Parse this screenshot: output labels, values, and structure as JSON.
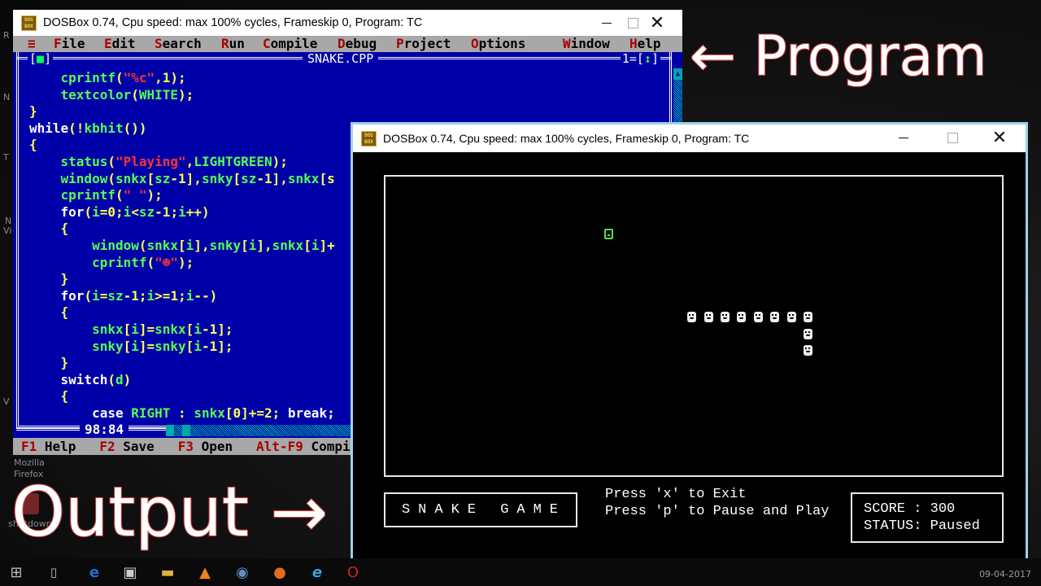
{
  "desktop": {
    "left_labels": [
      "R",
      "N",
      "T",
      "N",
      "Vi",
      "V"
    ],
    "icons": [
      {
        "label_line1": "Mozilla",
        "label_line2": "Firefox"
      },
      {
        "label_line1": "shutdown",
        "label_line2": ""
      }
    ]
  },
  "annotations": {
    "program": "← Program",
    "output": "Output →"
  },
  "ide_window": {
    "icon": "dosbox-icon",
    "icon_text": "DOS BOX",
    "title": "DOSBox 0.74, Cpu speed: max 100% cycles, Frameskip  0, Program:     TC",
    "controls": {
      "minimize": "—",
      "maximize": "☐",
      "close": "✕"
    },
    "menu": [
      {
        "hot": "≡",
        "rest": ""
      },
      {
        "hot": "F",
        "rest": "ile"
      },
      {
        "hot": "E",
        "rest": "dit"
      },
      {
        "hot": "S",
        "rest": "earch"
      },
      {
        "hot": "R",
        "rest": "un"
      },
      {
        "hot": "C",
        "rest": "ompile"
      },
      {
        "hot": "D",
        "rest": "ebug"
      },
      {
        "hot": "P",
        "rest": "roject"
      },
      {
        "hot": "O",
        "rest": "ptions"
      },
      {
        "hot": "W",
        "rest": "indow"
      },
      {
        "hot": "H",
        "rest": "elp"
      }
    ],
    "editor": {
      "close_box": "[",
      "close_box_mark": "■",
      "close_box_end": "]",
      "filename": "SNAKE.CPP",
      "window_number": "1=[",
      "zoom_mark": "↕",
      "window_number_end": "]",
      "cursor_position": "98:84",
      "code_lines": [
        [
          {
            "t": "    ",
            "c": "kw"
          },
          {
            "t": "cprintf",
            "c": "id"
          },
          {
            "t": "(",
            "c": "pn"
          },
          {
            "t": "\"%c\"",
            "c": "st"
          },
          {
            "t": ",1);",
            "c": "pn"
          }
        ],
        [
          {
            "t": "    ",
            "c": "kw"
          },
          {
            "t": "textcolor",
            "c": "id"
          },
          {
            "t": "(",
            "c": "pn"
          },
          {
            "t": "WHITE",
            "c": "id"
          },
          {
            "t": ");",
            "c": "pn"
          }
        ],
        [
          {
            "t": "}",
            "c": "pn"
          }
        ],
        [
          {
            "t": "while",
            "c": "kw"
          },
          {
            "t": "(!",
            "c": "pn"
          },
          {
            "t": "kbhit",
            "c": "id"
          },
          {
            "t": "())",
            "c": "pn"
          }
        ],
        [
          {
            "t": "{",
            "c": "pn"
          }
        ],
        [
          {
            "t": "    ",
            "c": "kw"
          },
          {
            "t": "status",
            "c": "id"
          },
          {
            "t": "(",
            "c": "pn"
          },
          {
            "t": "\"Playing\"",
            "c": "st"
          },
          {
            "t": ",",
            "c": "pn"
          },
          {
            "t": "LIGHTGREEN",
            "c": "id"
          },
          {
            "t": ");",
            "c": "pn"
          }
        ],
        [
          {
            "t": "    ",
            "c": "kw"
          },
          {
            "t": "window",
            "c": "id"
          },
          {
            "t": "(",
            "c": "pn"
          },
          {
            "t": "snkx",
            "c": "id"
          },
          {
            "t": "[",
            "c": "pn"
          },
          {
            "t": "sz",
            "c": "id"
          },
          {
            "t": "-1],",
            "c": "pn"
          },
          {
            "t": "snky",
            "c": "id"
          },
          {
            "t": "[",
            "c": "pn"
          },
          {
            "t": "sz",
            "c": "id"
          },
          {
            "t": "-1],",
            "c": "pn"
          },
          {
            "t": "snkx",
            "c": "id"
          },
          {
            "t": "[s",
            "c": "pn"
          }
        ],
        [
          {
            "t": "    ",
            "c": "kw"
          },
          {
            "t": "cprintf",
            "c": "id"
          },
          {
            "t": "(",
            "c": "pn"
          },
          {
            "t": "\" \"",
            "c": "st"
          },
          {
            "t": ");",
            "c": "pn"
          }
        ],
        [
          {
            "t": "    ",
            "c": "kw"
          },
          {
            "t": "for",
            "c": "kw"
          },
          {
            "t": "(",
            "c": "pn"
          },
          {
            "t": "i",
            "c": "id"
          },
          {
            "t": "=0;",
            "c": "pn"
          },
          {
            "t": "i",
            "c": "id"
          },
          {
            "t": "<",
            "c": "pn"
          },
          {
            "t": "sz",
            "c": "id"
          },
          {
            "t": "-1;",
            "c": "pn"
          },
          {
            "t": "i",
            "c": "id"
          },
          {
            "t": "++)",
            "c": "pn"
          }
        ],
        [
          {
            "t": "    {",
            "c": "pn"
          }
        ],
        [
          {
            "t": "        ",
            "c": "kw"
          },
          {
            "t": "window",
            "c": "id"
          },
          {
            "t": "(",
            "c": "pn"
          },
          {
            "t": "snkx",
            "c": "id"
          },
          {
            "t": "[",
            "c": "pn"
          },
          {
            "t": "i",
            "c": "id"
          },
          {
            "t": "],",
            "c": "pn"
          },
          {
            "t": "snky",
            "c": "id"
          },
          {
            "t": "[",
            "c": "pn"
          },
          {
            "t": "i",
            "c": "id"
          },
          {
            "t": "],",
            "c": "pn"
          },
          {
            "t": "snkx",
            "c": "id"
          },
          {
            "t": "[",
            "c": "pn"
          },
          {
            "t": "i",
            "c": "id"
          },
          {
            "t": "]+",
            "c": "pn"
          }
        ],
        [
          {
            "t": "        ",
            "c": "kw"
          },
          {
            "t": "cprintf",
            "c": "id"
          },
          {
            "t": "(",
            "c": "pn"
          },
          {
            "t": "\"☻\"",
            "c": "st"
          },
          {
            "t": ");",
            "c": "pn"
          }
        ],
        [
          {
            "t": "    }",
            "c": "pn"
          }
        ],
        [
          {
            "t": "    ",
            "c": "kw"
          },
          {
            "t": "for",
            "c": "kw"
          },
          {
            "t": "(",
            "c": "pn"
          },
          {
            "t": "i",
            "c": "id"
          },
          {
            "t": "=",
            "c": "pn"
          },
          {
            "t": "sz",
            "c": "id"
          },
          {
            "t": "-1;",
            "c": "pn"
          },
          {
            "t": "i",
            "c": "id"
          },
          {
            "t": ">=1;",
            "c": "pn"
          },
          {
            "t": "i",
            "c": "id"
          },
          {
            "t": "--)",
            "c": "pn"
          }
        ],
        [
          {
            "t": "    {",
            "c": "pn"
          }
        ],
        [
          {
            "t": "        ",
            "c": "kw"
          },
          {
            "t": "snkx",
            "c": "id"
          },
          {
            "t": "[",
            "c": "pn"
          },
          {
            "t": "i",
            "c": "id"
          },
          {
            "t": "]=",
            "c": "pn"
          },
          {
            "t": "snkx",
            "c": "id"
          },
          {
            "t": "[",
            "c": "pn"
          },
          {
            "t": "i",
            "c": "id"
          },
          {
            "t": "-1];",
            "c": "pn"
          }
        ],
        [
          {
            "t": "        ",
            "c": "kw"
          },
          {
            "t": "snky",
            "c": "id"
          },
          {
            "t": "[",
            "c": "pn"
          },
          {
            "t": "i",
            "c": "id"
          },
          {
            "t": "]=",
            "c": "pn"
          },
          {
            "t": "snky",
            "c": "id"
          },
          {
            "t": "[",
            "c": "pn"
          },
          {
            "t": "i",
            "c": "id"
          },
          {
            "t": "-1];",
            "c": "pn"
          }
        ],
        [
          {
            "t": "    }",
            "c": "pn"
          }
        ],
        [
          {
            "t": "    ",
            "c": "kw"
          },
          {
            "t": "switch",
            "c": "kw"
          },
          {
            "t": "(",
            "c": "pn"
          },
          {
            "t": "d",
            "c": "id"
          },
          {
            "t": ")",
            "c": "pn"
          }
        ],
        [
          {
            "t": "    {",
            "c": "pn"
          }
        ],
        [
          {
            "t": "        ",
            "c": "kw"
          },
          {
            "t": "case ",
            "c": "kw"
          },
          {
            "t": "RIGHT",
            "c": "id"
          },
          {
            "t": " : ",
            "c": "pn"
          },
          {
            "t": "snkx",
            "c": "id"
          },
          {
            "t": "[0]+=2; ",
            "c": "pn"
          },
          {
            "t": "break;",
            "c": "kw"
          }
        ]
      ]
    },
    "function_keys": [
      {
        "key": "F1",
        "label": "Help"
      },
      {
        "key": "F2",
        "label": "Save"
      },
      {
        "key": "F3",
        "label": "Open"
      },
      {
        "key": "Alt-F9",
        "label": "Compil"
      }
    ]
  },
  "output_window": {
    "title": "DOSBox 0.74, Cpu speed: max 100% cycles, Frameskip  0, Program:     TC",
    "controls": {
      "minimize": "—",
      "maximize": "☐",
      "close": "✕"
    },
    "game": {
      "title": "SNAKE GAME",
      "help_lines": [
        "Press 'x' to Exit",
        "Press 'p' to Pause and Play"
      ],
      "score_label": "SCORE : ",
      "score": "300",
      "status_label": "STATUS: ",
      "status": "Paused",
      "food": {
        "col": 36,
        "row": 4
      },
      "snake_segments": [
        {
          "col": 46,
          "row": 9
        },
        {
          "col": 48,
          "row": 9
        },
        {
          "col": 50,
          "row": 9
        },
        {
          "col": 52,
          "row": 9
        },
        {
          "col": 54,
          "row": 9
        },
        {
          "col": 56,
          "row": 9
        },
        {
          "col": 58,
          "row": 9
        },
        {
          "col": 60,
          "row": 9
        },
        {
          "col": 60,
          "row": 10
        },
        {
          "col": 60,
          "row": 11
        }
      ]
    }
  },
  "taskbar": {
    "icons": [
      "start-icon",
      "task-view-icon",
      "edge-icon",
      "store-icon",
      "file-explorer-icon",
      "vlc-icon",
      "media-icon",
      "firefox-icon",
      "ie-icon",
      "opera-icon"
    ],
    "date": "09-04-2017"
  }
}
